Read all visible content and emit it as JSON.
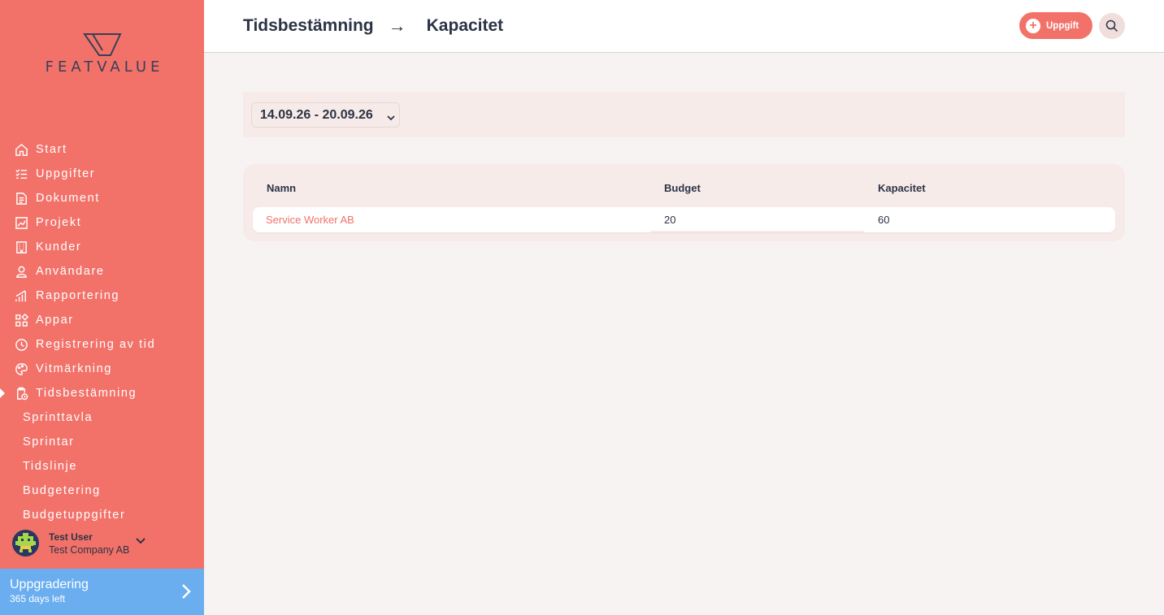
{
  "brand": {
    "name": "FEATVALUE"
  },
  "nav": {
    "items": [
      {
        "label": "Start",
        "icon": "home-icon"
      },
      {
        "label": "Uppgifter",
        "icon": "checklist-icon"
      },
      {
        "label": "Dokument",
        "icon": "document-icon"
      },
      {
        "label": "Projekt",
        "icon": "chart-icon"
      },
      {
        "label": "Kunder",
        "icon": "building-icon"
      },
      {
        "label": "Användare",
        "icon": "user-icon"
      },
      {
        "label": "Rapportering",
        "icon": "bar-chart-icon"
      },
      {
        "label": "Appar",
        "icon": "apps-icon"
      },
      {
        "label": "Registrering av tid",
        "icon": "timer-icon"
      },
      {
        "label": "Vitmärkning",
        "icon": "palette-icon"
      },
      {
        "label": "Tidsbestämning",
        "icon": "clipboard-clock-icon",
        "active": true
      }
    ],
    "subitems": [
      {
        "label": "Sprinttavla"
      },
      {
        "label": "Sprintar"
      },
      {
        "label": "Tidslinje"
      },
      {
        "label": "Budgetering"
      },
      {
        "label": "Budgetuppgifter"
      }
    ]
  },
  "user": {
    "name": "Test User",
    "company": "Test Company AB"
  },
  "upgrade": {
    "title": "Uppgradering",
    "subtitle": "365 days left"
  },
  "header": {
    "breadcrumb": {
      "parent": "Tidsbestämning",
      "separator": "→",
      "current": "Kapacitet"
    },
    "add_button_label": "Uppgift"
  },
  "filter": {
    "date_range": "14.09.26 - 20.09.26"
  },
  "table": {
    "headers": {
      "name": "Namn",
      "budget": "Budget",
      "capacity": "Kapacitet"
    },
    "rows": [
      {
        "name": "Service Worker AB",
        "budget": "20",
        "capacity": "60"
      }
    ]
  },
  "colors": {
    "accent": "#f2726a",
    "upgrade": "#6aaef0",
    "text": "#2c3345"
  }
}
